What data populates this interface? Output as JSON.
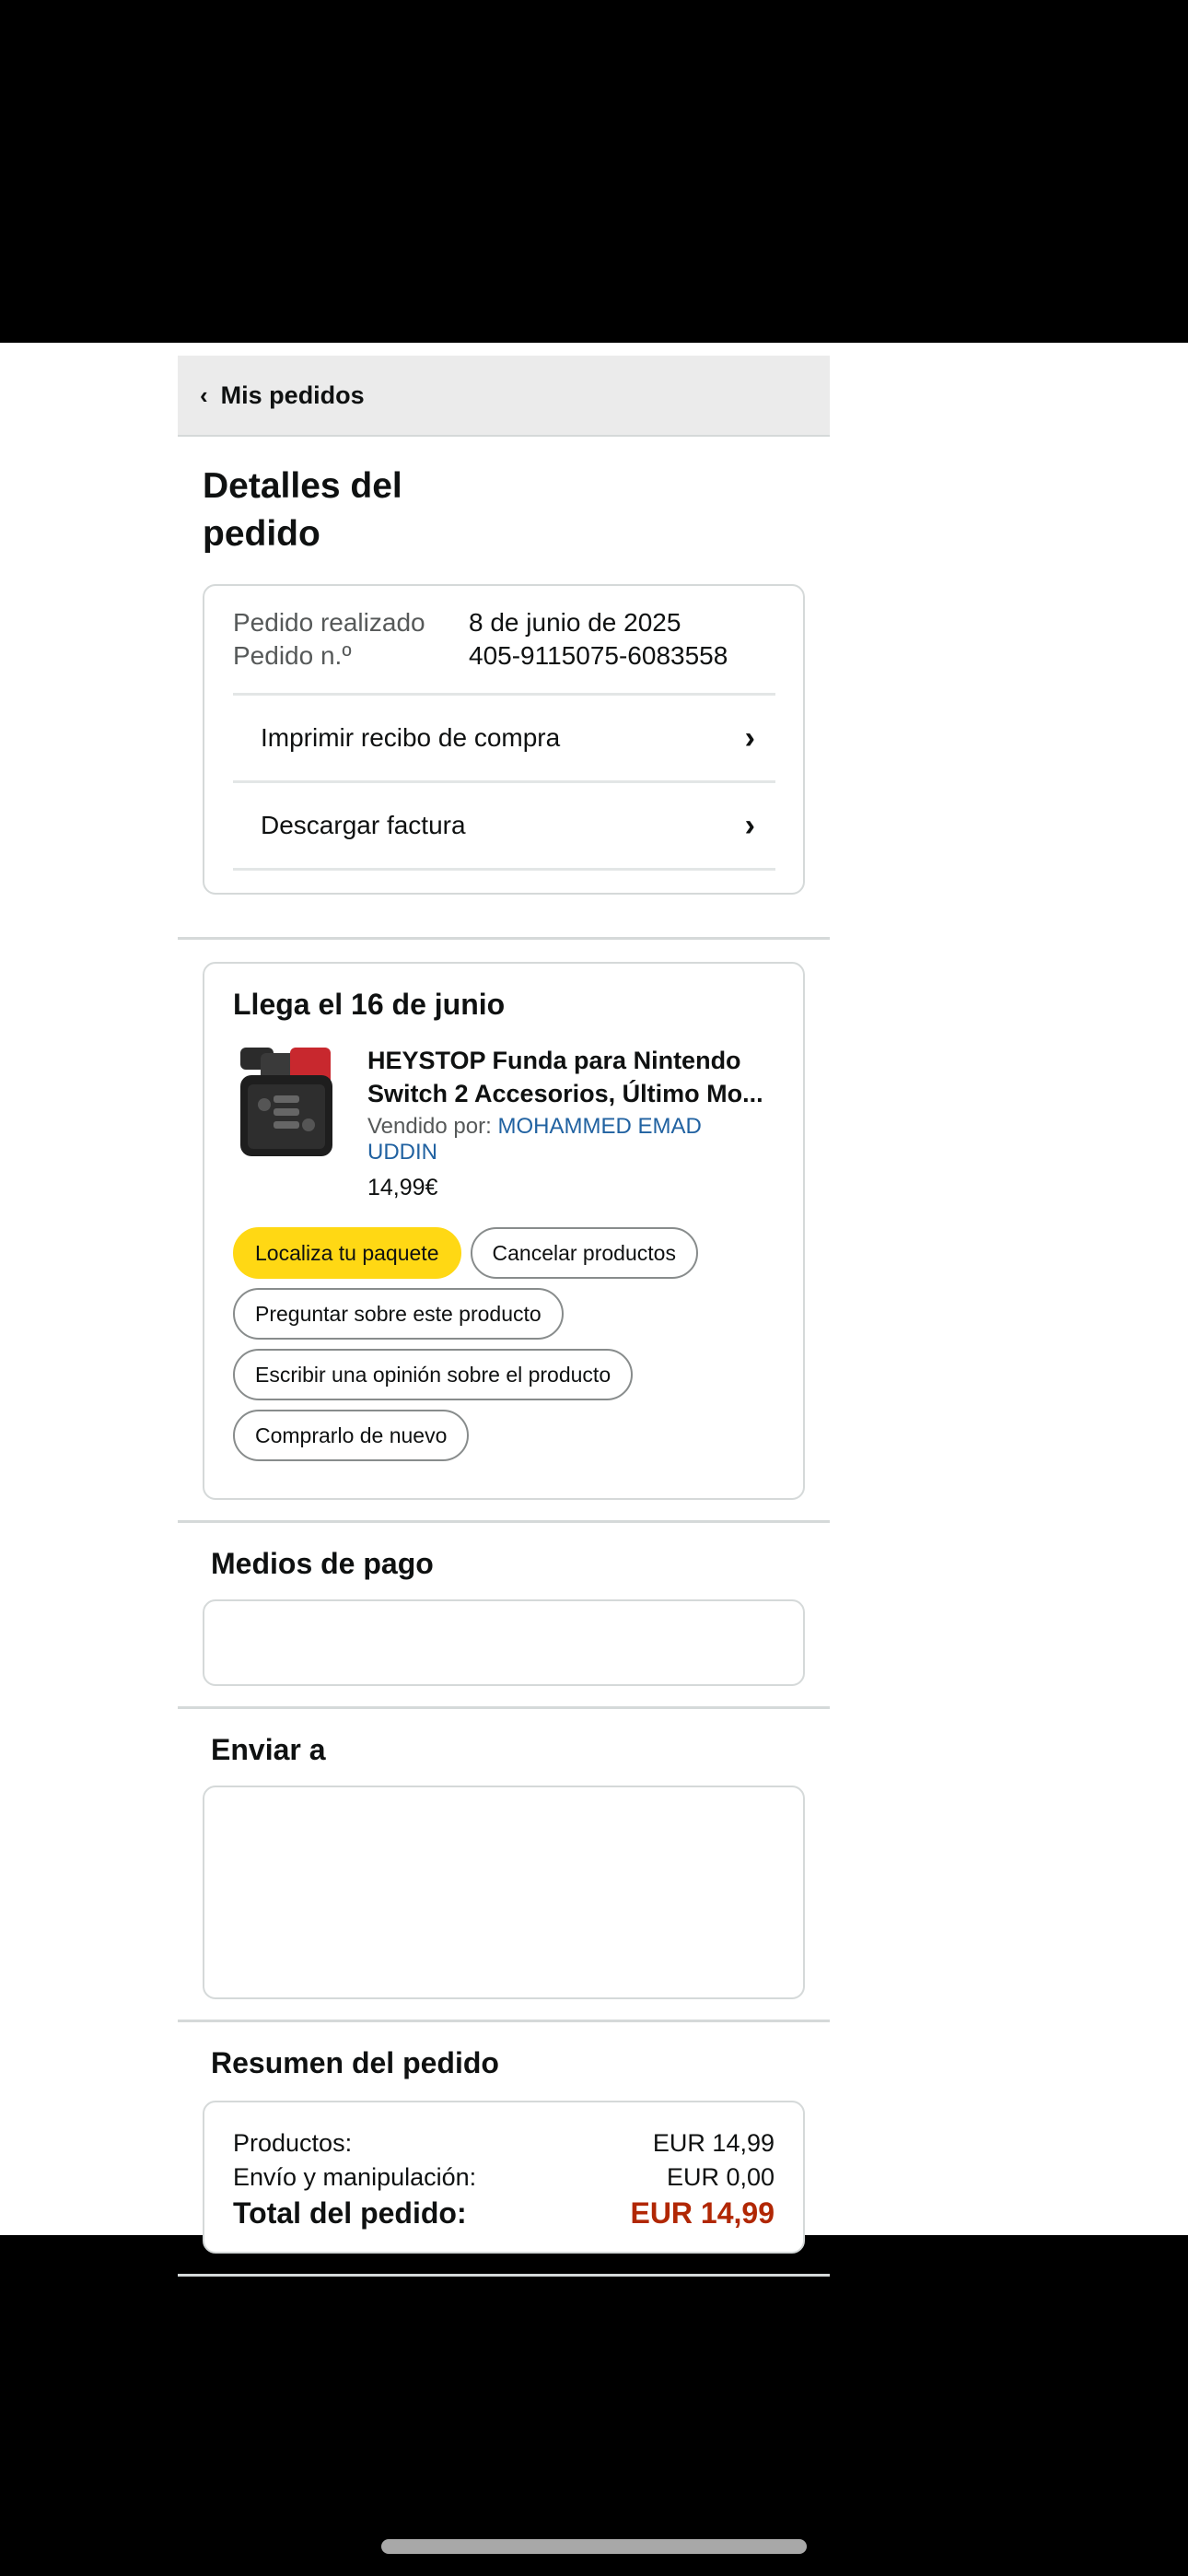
{
  "nav": {
    "back_label": "Mis pedidos"
  },
  "page": {
    "title": "Detalles del pedido"
  },
  "order": {
    "placed_label": "Pedido realizado",
    "placed_value": "8 de junio de 2025",
    "number_label": "Pedido n.º",
    "number_value": "405-9115075-6083558",
    "links": [
      "Imprimir recibo de compra",
      "Descargar factura"
    ]
  },
  "shipment": {
    "title": "Llega el 16 de junio",
    "item_title": "HEYSTOP Funda para Nintendo Switch 2 Accesorios, Último Mo...",
    "sold_by_label": "Vendido por:",
    "seller": "MOHAMMED EMAD UDDIN",
    "price": "14,99€",
    "buttons": {
      "track": "Localiza tu paquete",
      "cancel": "Cancelar productos",
      "ask": "Preguntar sobre este producto",
      "review": "Escribir una opinión sobre el producto",
      "buy_again": "Comprarlo de nuevo"
    }
  },
  "payment": {
    "title": "Medios de pago"
  },
  "shipping": {
    "title": "Enviar a"
  },
  "summary": {
    "title": "Resumen del pedido",
    "products_label": "Productos:",
    "products_value": "EUR 14,99",
    "shipping_label": "Envío y manipulación:",
    "shipping_value": "EUR 0,00",
    "total_label": "Total del pedido:",
    "total_value": "EUR 14,99"
  },
  "colors": {
    "primary_button": "#ffd814",
    "link": "#2162a1",
    "total_price": "#b12704"
  }
}
